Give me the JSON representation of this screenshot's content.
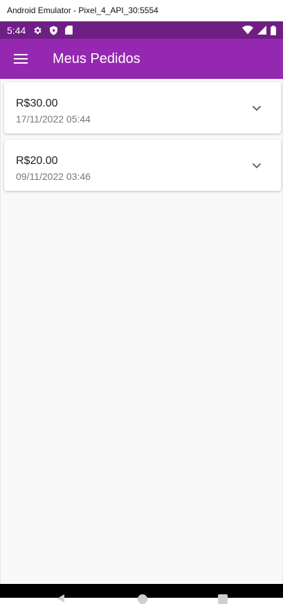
{
  "window": {
    "title": "Android Emulator - Pixel_4_API_30:5554"
  },
  "status_bar": {
    "time": "5:44",
    "icons": [
      "settings-gear-icon",
      "shield-play-icon",
      "sd-card-icon",
      "wifi-icon",
      "cellular-signal-icon",
      "battery-icon"
    ]
  },
  "app_bar": {
    "title": "Meus Pedidos",
    "menu_icon": "hamburger-menu-icon"
  },
  "orders": [
    {
      "amount": "R$30.00",
      "datetime": "17/11/2022 05:44"
    },
    {
      "amount": "R$20.00",
      "datetime": "09/11/2022 03:46"
    }
  ],
  "nav_bar": {
    "buttons": [
      "back",
      "home",
      "recents"
    ]
  },
  "colors": {
    "app_bar": "#9528b0",
    "status_bar": "#6f1f83",
    "background": "#f9f9f9",
    "card": "#ffffff"
  }
}
